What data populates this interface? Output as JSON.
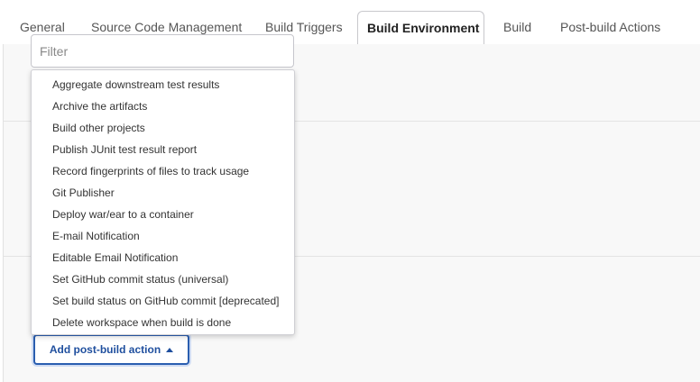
{
  "tabs": [
    {
      "label": "General"
    },
    {
      "label": "Source Code Management"
    },
    {
      "label": "Build Triggers"
    },
    {
      "label": "Build Environment"
    },
    {
      "label": "Build"
    },
    {
      "label": "Post-build Actions"
    }
  ],
  "active_tab": "Build Environment",
  "filter": {
    "placeholder": "Filter",
    "value": ""
  },
  "menu": {
    "items": [
      {
        "label": "Aggregate downstream test results"
      },
      {
        "label": "Archive the artifacts"
      },
      {
        "label": "Build other projects"
      },
      {
        "label": "Publish JUnit test result report"
      },
      {
        "label": "Record fingerprints of files to track usage"
      },
      {
        "label": "Git Publisher"
      },
      {
        "label": "Deploy war/ear to a container"
      },
      {
        "label": "E-mail Notification"
      },
      {
        "label": "Editable Email Notification"
      },
      {
        "label": "Set GitHub commit status (universal)"
      },
      {
        "label": "Set build status on GitHub commit [deprecated]"
      },
      {
        "label": "Delete workspace when build is done"
      }
    ]
  },
  "add_button": {
    "label": "Add post-build action",
    "icon": "caret-up-icon"
  },
  "colors": {
    "accent": "#1f4f9e",
    "panel": "#f8f8f8"
  }
}
